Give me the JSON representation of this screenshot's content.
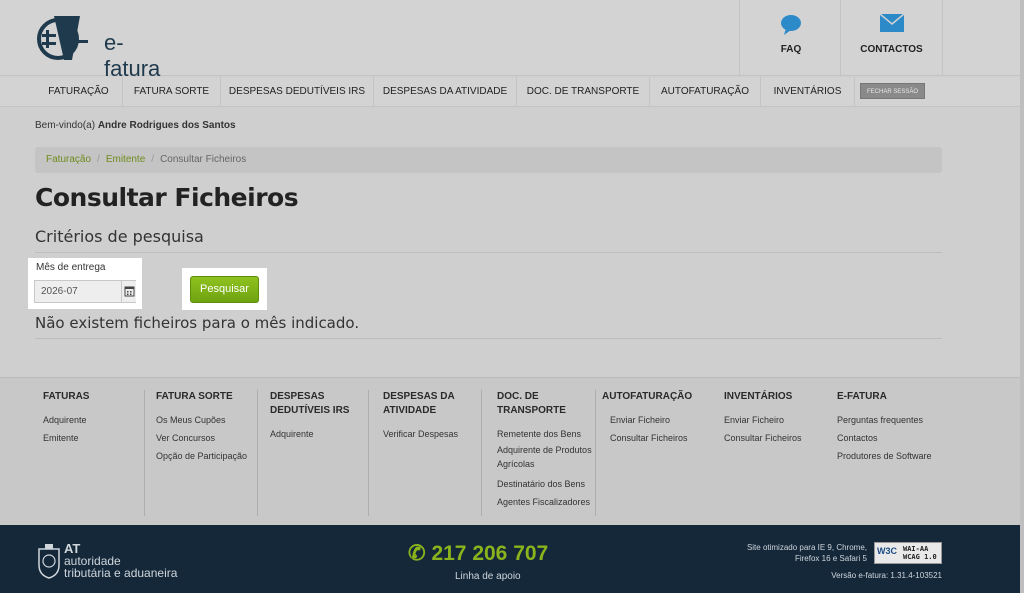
{
  "header": {
    "logo_text": "e-fatura",
    "faq_label": "FAQ",
    "contacts_label": "CONTACTOS"
  },
  "nav": {
    "items": [
      "FATURAÇÃO",
      "FATURA SORTE",
      "DESPESAS DEDUTÍVEIS IRS",
      "DESPESAS DA ATIVIDADE",
      "DOC. DE TRANSPORTE",
      "AUTOFATURAÇÃO",
      "INVENTÁRIOS"
    ],
    "logout": "FECHAR SESSÃO"
  },
  "welcome": {
    "prefix": "Bem-vindo(a)",
    "user": "Andre Rodrigues dos Santos"
  },
  "breadcrumb": [
    "Faturação",
    "Emitente",
    "Consultar Ficheiros"
  ],
  "page": {
    "title": "Consultar Ficheiros",
    "subtitle": "Critérios de pesquisa",
    "field_label": "Mês de entrega",
    "field_value": "2026-07",
    "search_button": "Pesquisar",
    "no_results": "Não existem ficheiros para o mês indicado."
  },
  "footer": {
    "columns": [
      {
        "title": "FATURAS",
        "links": [
          "Adquirente",
          "Emitente"
        ]
      },
      {
        "title": "FATURA SORTE",
        "links": [
          "Os Meus Cupões",
          "Ver Concursos",
          "Opção de Participação"
        ]
      },
      {
        "title": "DESPESAS DEDUTÍVEIS IRS",
        "links": [
          "Adquirente"
        ]
      },
      {
        "title": "DESPESAS DA ATIVIDADE",
        "links": [
          "Verificar Despesas"
        ]
      },
      {
        "title": "DOC. DE TRANSPORTE",
        "links": [
          "Remetente dos Bens",
          "Adquirente de Produtos Agrícolas",
          "Destinatário dos Bens",
          "Agentes Fiscalizadores"
        ]
      },
      {
        "title": "AUTOFATURAÇÃO",
        "links": [
          "Enviar Ficheiro",
          "Consultar Ficheiros"
        ]
      },
      {
        "title": "INVENTÁRIOS",
        "links": [
          "Enviar Ficheiro",
          "Consultar Ficheiros"
        ]
      },
      {
        "title": "E-FATURA",
        "links": [
          "Perguntas frequentes",
          "Contactos",
          "Produtores de Software"
        ]
      }
    ]
  },
  "bottom": {
    "at_short": "AT",
    "at_line1": "autoridade",
    "at_line2": "tributária e aduaneira",
    "phone": "217 206 707",
    "phone_label": "Linha de apoio",
    "site_info": "Site otimizado para IE 9, Chrome, Firefox 16 e Safari 5",
    "wcag_badge": "W3C",
    "wcag_line1": "WAI-AA",
    "wcag_line2": "WCAG 1.0",
    "version": "Versão e-fatura: 1.31.4-103521"
  },
  "colors": {
    "accent_green": "#6fa311",
    "footer_dark": "#15283a",
    "link_green": "#6f8b1c"
  }
}
